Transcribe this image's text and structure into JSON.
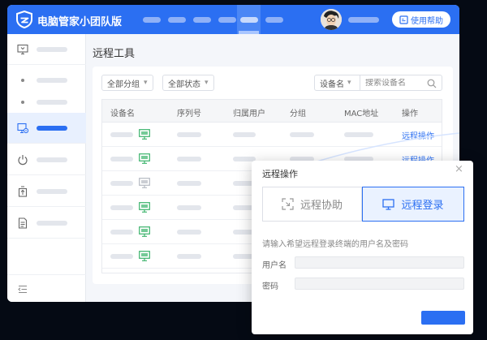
{
  "app": {
    "title": "电脑管家小团队版",
    "help_label": "使用帮助",
    "accent": "#2b6ff2"
  },
  "header": {
    "nav_items": [
      {
        "icon": "nav-placeholder"
      },
      {
        "icon": "nav-placeholder"
      },
      {
        "icon": "nav-placeholder"
      },
      {
        "icon": "nav-placeholder"
      },
      {
        "icon": "nav-placeholder",
        "active": true
      },
      {
        "icon": "nav-placeholder"
      }
    ]
  },
  "sidebar": {
    "items": [
      {
        "icon": "monitor-icon"
      },
      {
        "icon": "dot"
      },
      {
        "icon": "dot"
      },
      {
        "icon": "remote-monitor-icon",
        "active": true
      },
      {
        "icon": "power-icon"
      },
      {
        "icon": "upload-icon"
      },
      {
        "icon": "document-icon"
      }
    ],
    "collapse_icon": "collapse-icon"
  },
  "page": {
    "title": "远程工具"
  },
  "filters": {
    "group_label": "全部分组",
    "status_label": "全部状态",
    "search_type": "设备名",
    "search_placeholder": "搜索设备名"
  },
  "table": {
    "columns": [
      "设备名",
      "序列号",
      "归属用户",
      "分组",
      "MAC地址",
      "操作"
    ],
    "rows": [
      {
        "status": "online",
        "action": "远程操作"
      },
      {
        "status": "online",
        "action": "远程操作"
      },
      {
        "status": "offline",
        "action": ""
      },
      {
        "status": "online",
        "action": ""
      },
      {
        "status": "online",
        "action": ""
      },
      {
        "status": "online",
        "action": ""
      }
    ]
  },
  "dialog": {
    "title": "远程操作",
    "assist_label": "远程协助",
    "login_label": "远程登录",
    "hint": "请输入希望远程登录终端的用户名及密码",
    "username_label": "用户名",
    "password_label": "密码"
  }
}
